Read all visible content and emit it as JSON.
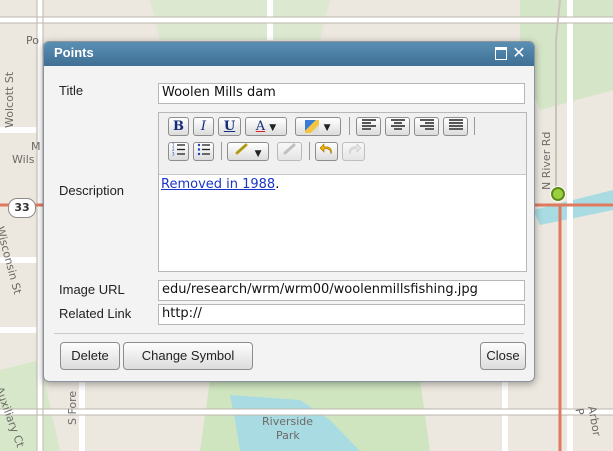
{
  "map": {
    "labels": [
      "Po",
      "Wolcott St",
      "M",
      "Wils",
      "N River Rd",
      "Wisconsin St",
      "Auxiliary Ct",
      "S Fore",
      "Riverside",
      "Park",
      "Arbor P"
    ],
    "route_shield": "33",
    "colors": {
      "background": "#ece7df",
      "water": "#a9dbe3",
      "park": "#cfe5c0",
      "road": "#ffffff",
      "highway": "#e07a5f"
    }
  },
  "dialog": {
    "title": "Points",
    "title_label": "Title",
    "title_value": "Woolen Mills dam",
    "description_label": "Description",
    "description_link_text": "Removed in 1988",
    "description_trailing": ".",
    "image_url_label": "Image URL",
    "image_url_value": "edu/research/wrm/wrm00/woolenmillsfishing.jpg",
    "related_link_label": "Related Link",
    "related_link_value": "http://",
    "buttons": {
      "delete": "Delete",
      "change_symbol": "Change Symbol",
      "close": "Close"
    },
    "toolbar": {
      "bold": "B",
      "italic": "I",
      "underline": "U",
      "font_color": "A",
      "icons": [
        "bold-icon",
        "italic-icon",
        "underline-icon",
        "font-color-icon",
        "highlight-color-icon",
        "align-left-icon",
        "align-center-icon",
        "align-right-icon",
        "justify-icon",
        "ordered-list-icon",
        "unordered-list-icon",
        "create-link-icon",
        "remove-link-icon",
        "undo-icon",
        "redo-icon"
      ]
    },
    "colors": {
      "titlebar": "#4a7fa6",
      "link": "#1a36c7"
    }
  }
}
